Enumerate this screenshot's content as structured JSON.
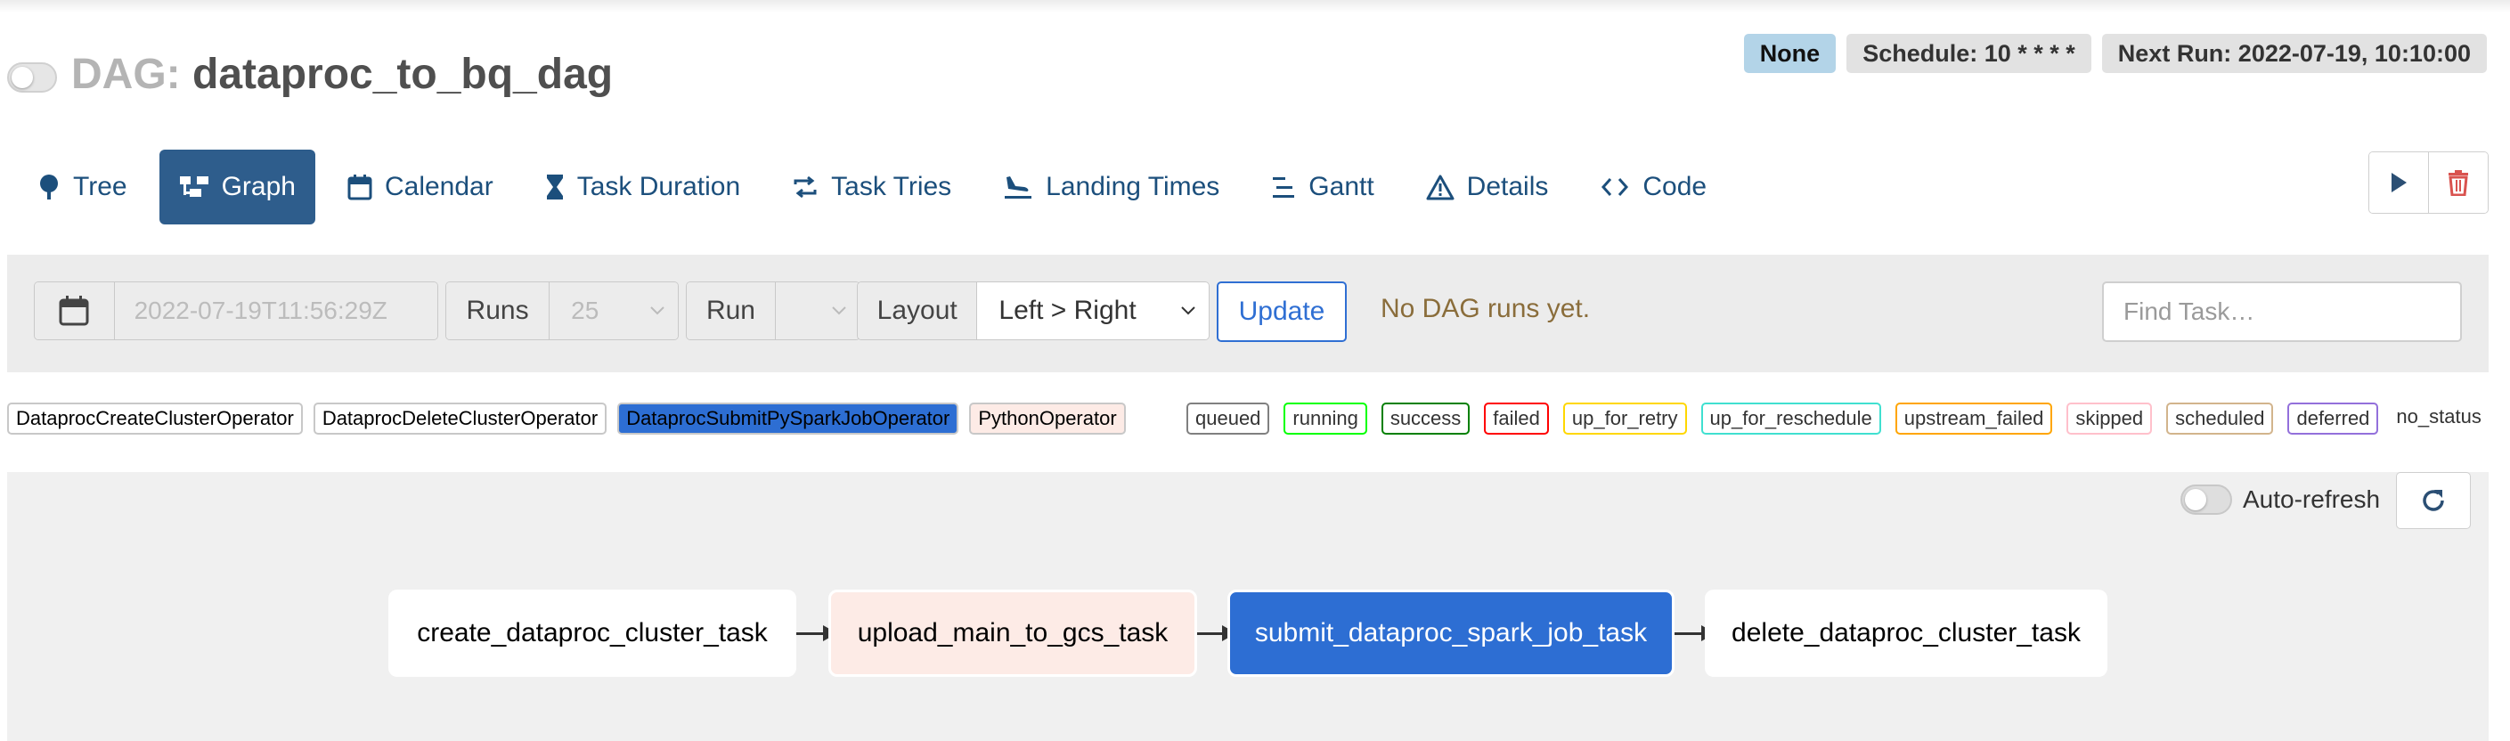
{
  "header": {
    "dag_prefix": "DAG:",
    "dag_name": "dataproc_to_bq_dag",
    "badges": {
      "none": "None",
      "schedule": "Schedule: 10 * * * *",
      "next_run": "Next Run: 2022-07-19, 10:10:00"
    }
  },
  "nav": {
    "tabs": [
      {
        "label": "Tree",
        "icon": "tree-icon",
        "active": false
      },
      {
        "label": "Graph",
        "icon": "graph-icon",
        "active": true
      },
      {
        "label": "Calendar",
        "icon": "calendar-icon",
        "active": false
      },
      {
        "label": "Task Duration",
        "icon": "hourglass-icon",
        "active": false
      },
      {
        "label": "Task Tries",
        "icon": "retry-icon",
        "active": false
      },
      {
        "label": "Landing Times",
        "icon": "landing-icon",
        "active": false
      },
      {
        "label": "Gantt",
        "icon": "gantt-icon",
        "active": false
      },
      {
        "label": "Details",
        "icon": "warning-icon",
        "active": false
      },
      {
        "label": "Code",
        "icon": "code-icon",
        "active": false
      }
    ],
    "actions": [
      "play-icon",
      "trash-icon"
    ]
  },
  "filters": {
    "date_value": "2022-07-19T11:56:29Z",
    "runs_label": "Runs",
    "runs_value": "25",
    "run_label": "Run",
    "run_value": "",
    "layout_label": "Layout",
    "layout_value": "Left > Right",
    "update_label": "Update",
    "no_runs_text": "No DAG runs yet.",
    "find_placeholder": "Find Task…"
  },
  "legend": {
    "operators": [
      {
        "label": "DataprocCreateClusterOperator",
        "bg": "#ffffff"
      },
      {
        "label": "DataprocDeleteClusterOperator",
        "bg": "#ffffff"
      },
      {
        "label": "DataprocSubmitPySparkJobOperator",
        "bg": "#2d6ed3"
      },
      {
        "label": "PythonOperator",
        "bg": "#fdebe6"
      }
    ],
    "states": [
      {
        "label": "queued",
        "color": "#808080"
      },
      {
        "label": "running",
        "color": "#00ff00"
      },
      {
        "label": "success",
        "color": "#008000"
      },
      {
        "label": "failed",
        "color": "#ff0000"
      },
      {
        "label": "up_for_retry",
        "color": "#ffd700"
      },
      {
        "label": "up_for_reschedule",
        "color": "#40e0d0"
      },
      {
        "label": "upstream_failed",
        "color": "#ffa500"
      },
      {
        "label": "skipped",
        "color": "#ffc0cb"
      },
      {
        "label": "scheduled",
        "color": "#d2b48c"
      },
      {
        "label": "deferred",
        "color": "#9370db"
      },
      {
        "label": "no_status",
        "color": ""
      }
    ]
  },
  "graph": {
    "auto_refresh_label": "Auto-refresh",
    "tasks": [
      "create_dataproc_cluster_task",
      "upload_main_to_gcs_task",
      "submit_dataproc_spark_job_task",
      "delete_dataproc_cluster_task"
    ]
  }
}
